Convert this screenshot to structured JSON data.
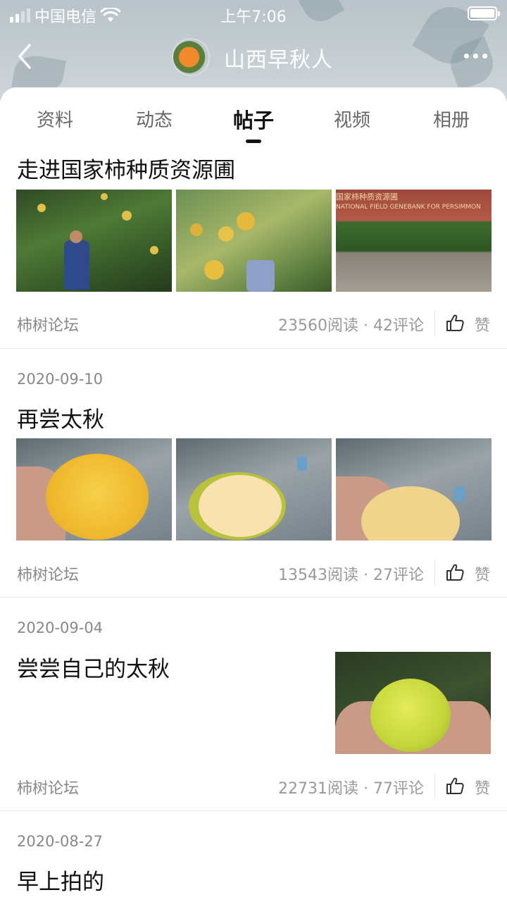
{
  "status_bar": {
    "carrier": "中国电信",
    "time": "上午7:06"
  },
  "profile": {
    "name": "山西早秋人"
  },
  "tabs": [
    {
      "label": "资料",
      "active": false
    },
    {
      "label": "动态",
      "active": false
    },
    {
      "label": "帖子",
      "active": true
    },
    {
      "label": "视频",
      "active": false
    },
    {
      "label": "相册",
      "active": false
    }
  ],
  "posts": [
    {
      "date": "",
      "title": "走进国家柿种质资源圃",
      "forum": "柿树论坛",
      "stats": "23560阅读 · 42评论",
      "like_label": "赞",
      "images": [
        "orchard-worker-photo",
        "persimmon-branch-photo",
        "genebank-gate-photo"
      ],
      "gate_sign": "国家柿种质资源圃 NATIONAL FIELD GENEBANK FOR PERSIMMON"
    },
    {
      "date": "2020-09-10",
      "title": "再尝太秋",
      "forum": "柿树论坛",
      "stats": "13543阅读 · 27评论",
      "like_label": "赞",
      "images": [
        "whole-persimmon-photo",
        "bitten-persimmon-photo",
        "bitten-persimmon-photo-2"
      ]
    },
    {
      "date": "2020-09-04",
      "title": "尝尝自己的太秋",
      "forum": "柿树论坛",
      "stats": "22731阅读 · 77评论",
      "like_label": "赞",
      "images": [
        "green-persimmon-photo"
      ]
    },
    {
      "date": "2020-08-27",
      "title": "早上拍的"
    }
  ],
  "colors": {
    "header_bg": "#c2cbd0",
    "text_primary": "#111111",
    "text_secondary": "#888888"
  }
}
